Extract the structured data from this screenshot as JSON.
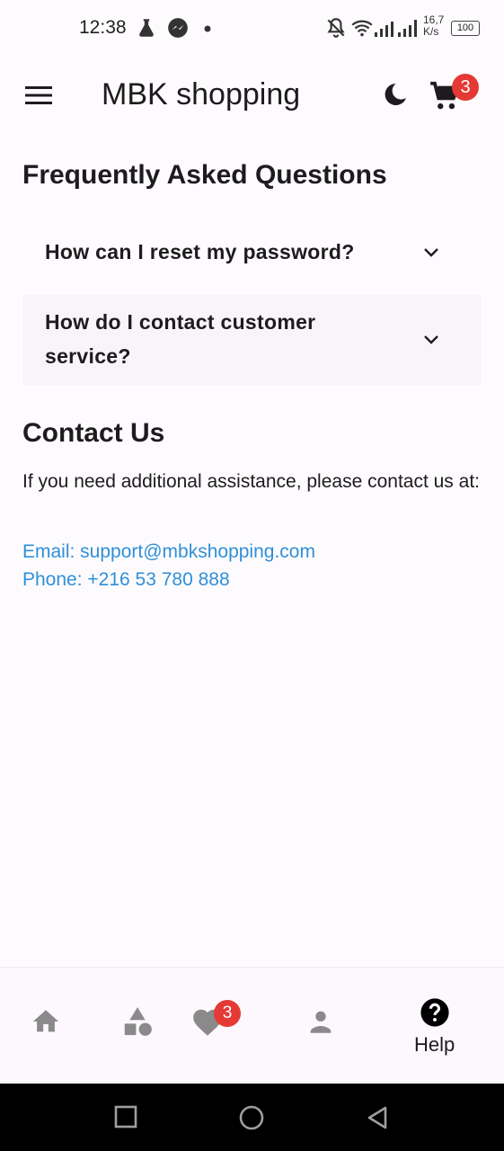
{
  "status_bar": {
    "time": "12:38",
    "speed_top": "16,7",
    "speed_bottom": "K/s",
    "battery": "100"
  },
  "app_bar": {
    "title": "MBK shopping",
    "cart_count": "3"
  },
  "faq": {
    "title": "Frequently Asked Questions",
    "items": [
      {
        "question": "How can I reset my password?"
      },
      {
        "question_line1": "How do I contact customer",
        "question_line2": "service?"
      }
    ]
  },
  "contact": {
    "title": "Contact Us",
    "text": "If you need additional assistance, please contact us at:",
    "email": "Email: support@mbkshopping.com",
    "phone": "Phone: +216 53 780 888"
  },
  "bottom_nav": {
    "favorites_count": "3",
    "help_label": "Help",
    "items": [
      "home-icon",
      "categories-icon",
      "favorites-icon",
      "profile-icon",
      "help-icon"
    ]
  },
  "colors": {
    "background": "#fefbfe",
    "link": "#2f8fd8",
    "badge": "#e53935",
    "faq_highlight": "#f8f4f8"
  }
}
